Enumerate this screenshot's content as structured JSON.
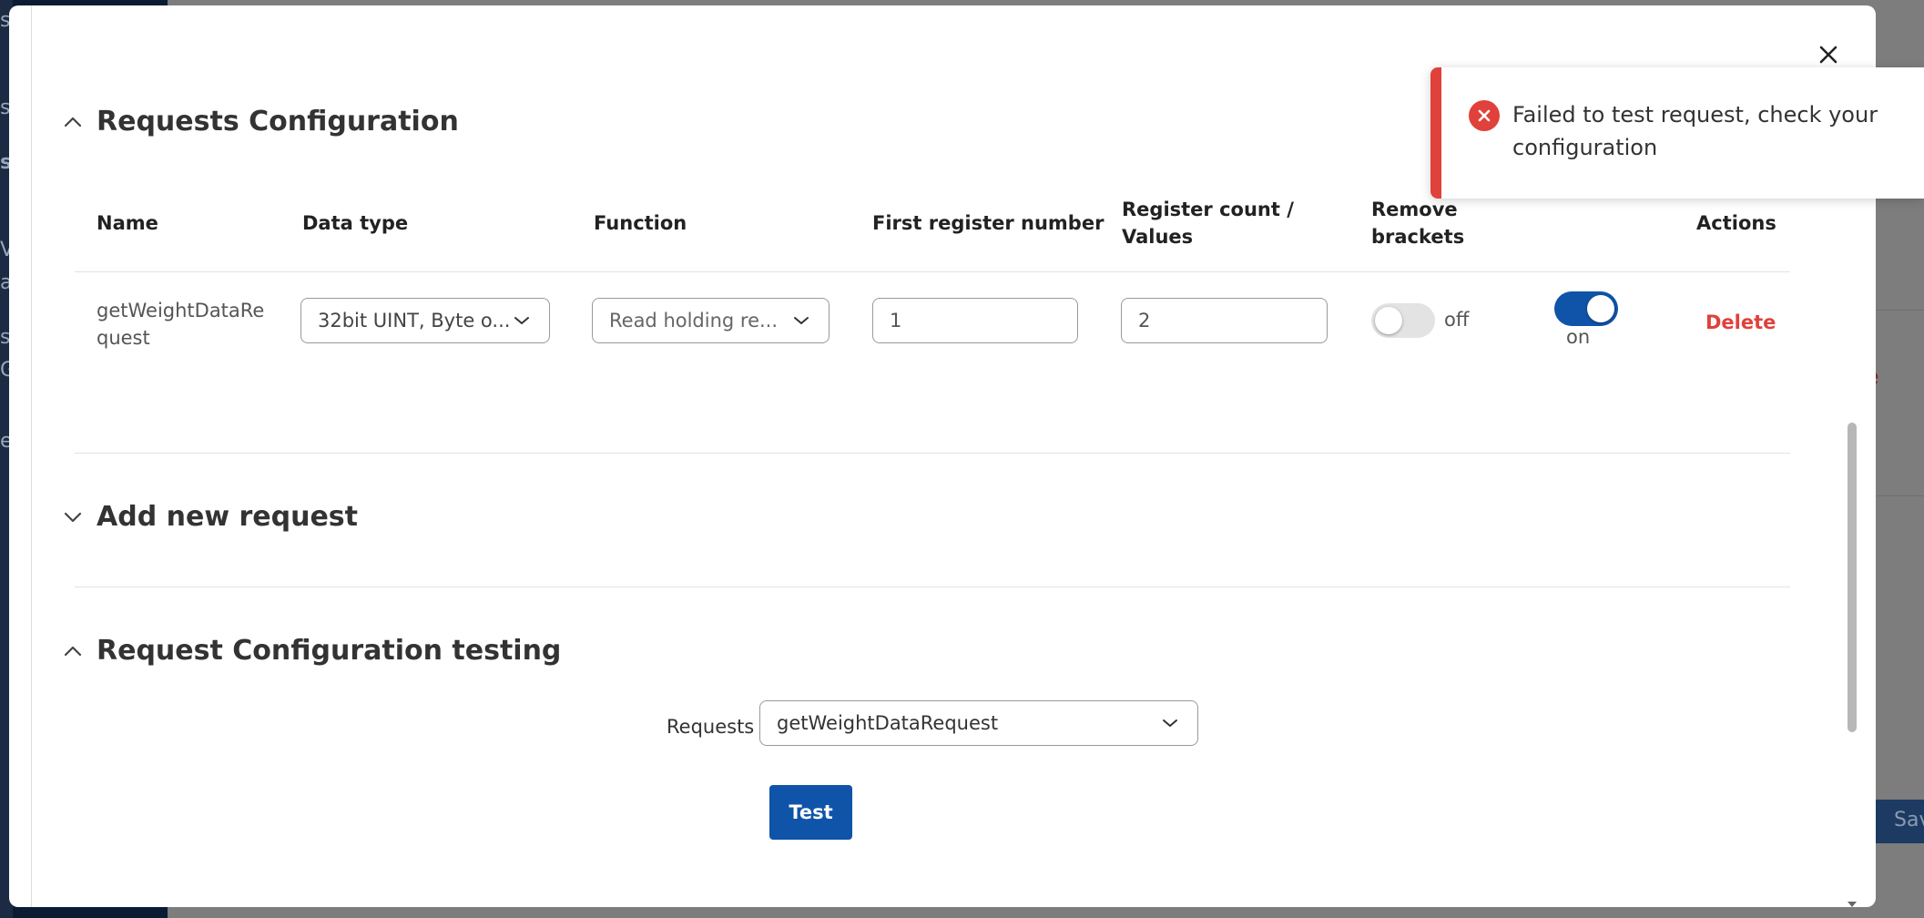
{
  "modal": {
    "close_icon": "close-icon"
  },
  "requests_section": {
    "title": "Requests Configuration",
    "columns": {
      "name": "Name",
      "data_type": "Data type",
      "function": "Function",
      "first_register": "First register number",
      "register_count_line1": "Register count /",
      "register_count_line2": "Values",
      "remove_brackets_line1": "Remove",
      "remove_brackets_line2": "brackets",
      "actions": "Actions"
    },
    "rows": [
      {
        "name_line1": "getWeightDataRe",
        "name_line2": "quest",
        "data_type": "32bit UINT, Byte o...",
        "function": "Read holding re...",
        "first_register": "1",
        "register_count": "2",
        "remove_brackets_label": "off",
        "enabled_label": "on",
        "delete_label": "Delete"
      }
    ]
  },
  "add_section": {
    "title": "Add new request"
  },
  "testing_section": {
    "title": "Request Configuration testing",
    "requests_label": "Requests",
    "requests_value": "getWeightDataRequest",
    "test_button": "Test"
  },
  "toast": {
    "message": "Failed to test request, check your configuration"
  },
  "background": {
    "save_partial": "Sav",
    "red_partial": "e",
    "sidebar_chars": [
      "s",
      "s",
      "s",
      "V",
      "ay",
      "s",
      "G",
      "e"
    ]
  },
  "colors": {
    "primary": "#0f54a8",
    "danger": "#e0413a",
    "sidebar": "#0b1b34"
  }
}
